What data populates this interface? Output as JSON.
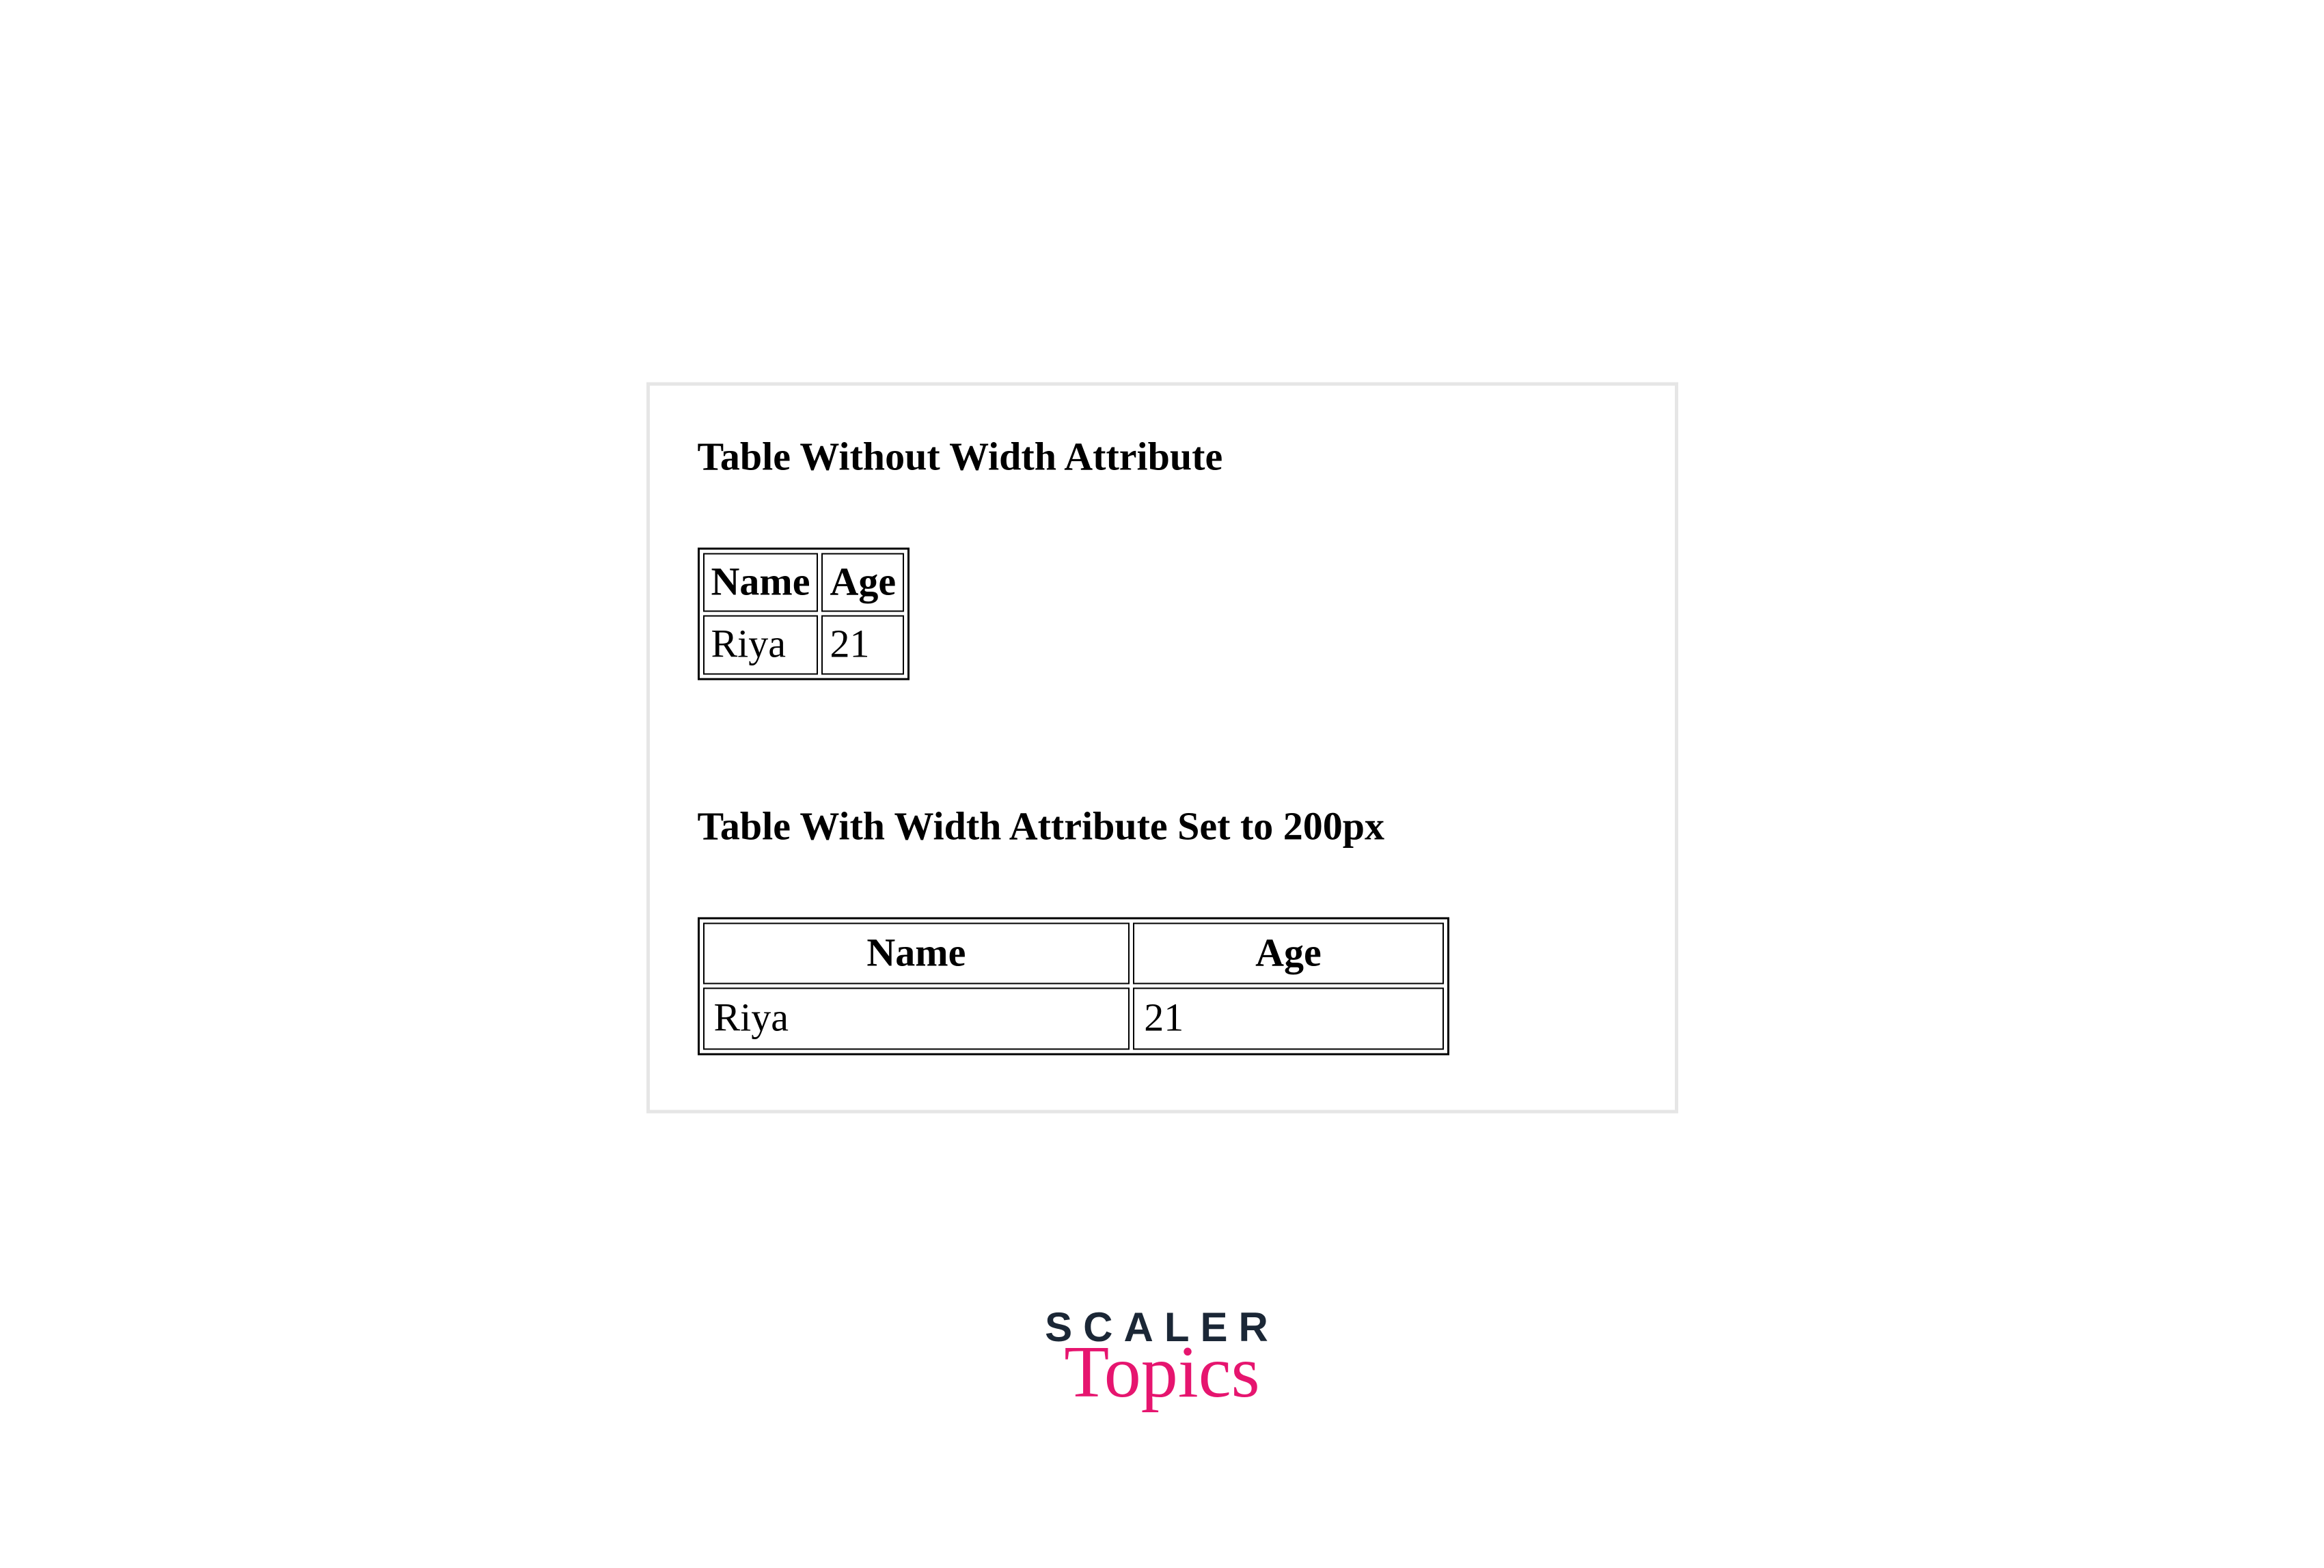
{
  "demo": {
    "heading1": "Table Without Width Attribute",
    "heading2": "Table With Width Attribute Set to 200px",
    "table": {
      "headers": {
        "col1": "Name",
        "col2": "Age"
      },
      "row1": {
        "col1": "Riya",
        "col2": "21"
      }
    }
  },
  "brand": {
    "top": "SCALER",
    "bottom": "Topics"
  }
}
